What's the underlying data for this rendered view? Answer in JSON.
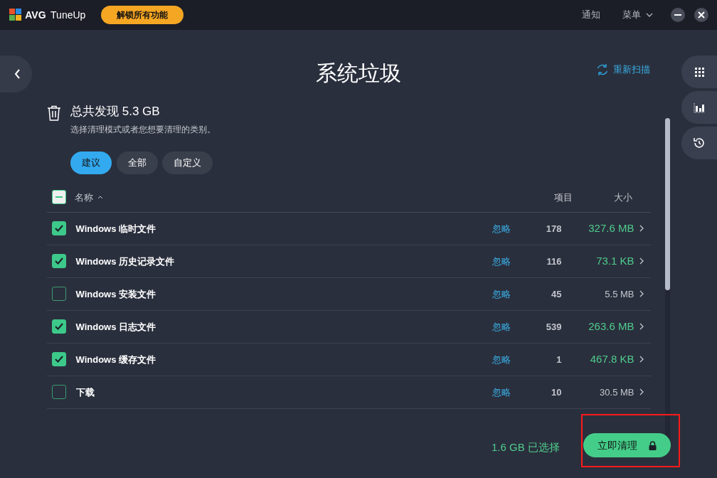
{
  "titlebar": {
    "brand": "AVG",
    "product": "TuneUp",
    "unlock_button": "解锁所有功能",
    "notify": "通知",
    "menu": "菜单"
  },
  "page": {
    "title": "系统垃圾",
    "rescan": "重新扫描"
  },
  "summary": {
    "title": "总共发现 5.3 GB",
    "subtitle": "选择清理模式或者您想要清理的类别。"
  },
  "modes": [
    {
      "label": "建议",
      "selected": true
    },
    {
      "label": "全部",
      "selected": false
    },
    {
      "label": "自定义",
      "selected": false
    }
  ],
  "table": {
    "select_all": {
      "partial": true
    },
    "columns": [
      "名称",
      "项目",
      "大小"
    ],
    "rows": [
      {
        "name": "Windows 临时文件",
        "ignore": "忽略",
        "count": "178",
        "size": "327.6 MB",
        "checked": true
      },
      {
        "name": "Windows 历史记录文件",
        "ignore": "忽略",
        "count": "116",
        "size": "73.1 KB",
        "checked": true
      },
      {
        "name": "Windows 安装文件",
        "ignore": "忽略",
        "count": "45",
        "size": "5.5 MB",
        "checked": false
      },
      {
        "name": "Windows 日志文件",
        "ignore": "忽略",
        "count": "539",
        "size": "263.6 MB",
        "checked": true
      },
      {
        "name": "Windows 缓存文件",
        "ignore": "忽略",
        "count": "1",
        "size": "467.8 KB",
        "checked": true
      },
      {
        "name": "下载",
        "ignore": "忽略",
        "count": "10",
        "size": "30.5 MB",
        "checked": false
      }
    ]
  },
  "footer": {
    "selected": "1.6 GB 已选择",
    "clean_button": "立即清理"
  }
}
